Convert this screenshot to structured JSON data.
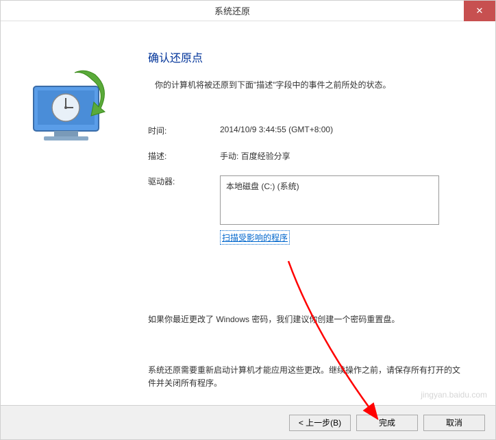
{
  "titlebar": {
    "title": "系统还原"
  },
  "main": {
    "heading": "确认还原点",
    "subtext": "你的计算机将被还原到下面\"描述\"字段中的事件之前所处的状态。",
    "time_label": "时间:",
    "time_value": "2014/10/9 3:44:55 (GMT+8:00)",
    "desc_label": "描述:",
    "desc_value": "手动: 百度经验分享",
    "drive_label": "驱动器:",
    "drive_value": "本地磁盘 (C:) (系统)",
    "scan_link": "扫描受影响的程序",
    "warning": "如果你最近更改了 Windows 密码，我们建议你创建一个密码重置盘。",
    "restart": "系统还原需要重新启动计算机才能应用这些更改。继续操作之前，请保存所有打开的文件并关闭所有程序。"
  },
  "buttons": {
    "back": "< 上一步(B)",
    "finish": "完成",
    "cancel": "取消"
  }
}
